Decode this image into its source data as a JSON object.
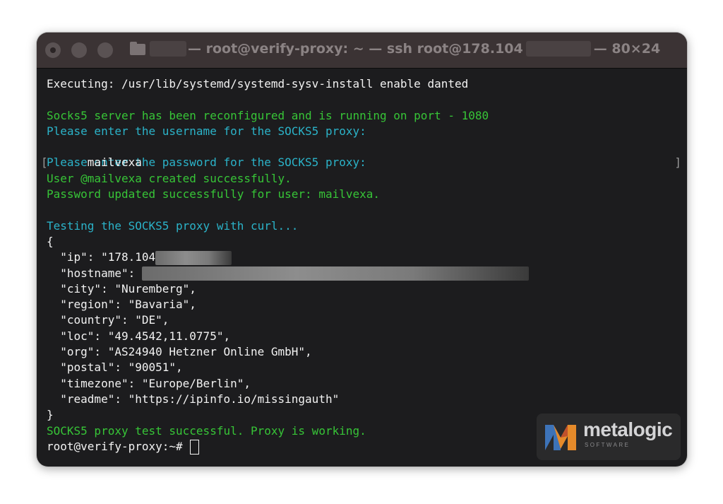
{
  "window": {
    "title_prefix": "— root@verify-proxy: ~ — ssh root@178.104",
    "title_suffix": "— 80×24"
  },
  "terminal": {
    "exec_line": "Executing: /usr/lib/systemd/systemd-sysv-install enable danted",
    "reconfigured": "Socks5 server has been reconfigured and is running on port - 1080",
    "prompt_username": "Please enter the username for the SOCKS5 proxy:",
    "username_input": "mailvexa",
    "prompt_password": "Please enter the password for the SOCKS5 proxy:",
    "user_created": "User @mailvexa created successfully.",
    "password_updated": "Password updated successfully for user: mailvexa.",
    "testing": "Testing the SOCKS5 proxy with curl...",
    "brace_open": "{",
    "json_ip": "  \"ip\": \"178.104",
    "json_hostname": "  \"hostname\": ",
    "json_city": "  \"city\": \"Nuremberg\",",
    "json_region": "  \"region\": \"Bavaria\",",
    "json_country": "  \"country\": \"DE\",",
    "json_loc": "  \"loc\": \"49.4542,11.0775\",",
    "json_org": "  \"org\": \"AS24940 Hetzner Online GmbH\",",
    "json_postal": "  \"postal\": \"90051\",",
    "json_timezone": "  \"timezone\": \"Europe/Berlin\",",
    "json_readme": "  \"readme\": \"https://ipinfo.io/missingauth\"",
    "brace_close": "}",
    "test_success": "SOCKS5 proxy test successful. Proxy is working.",
    "prompt": "root@verify-proxy:~# "
  },
  "watermark": {
    "name": "metalogic",
    "sub": "SOFTWARE"
  }
}
